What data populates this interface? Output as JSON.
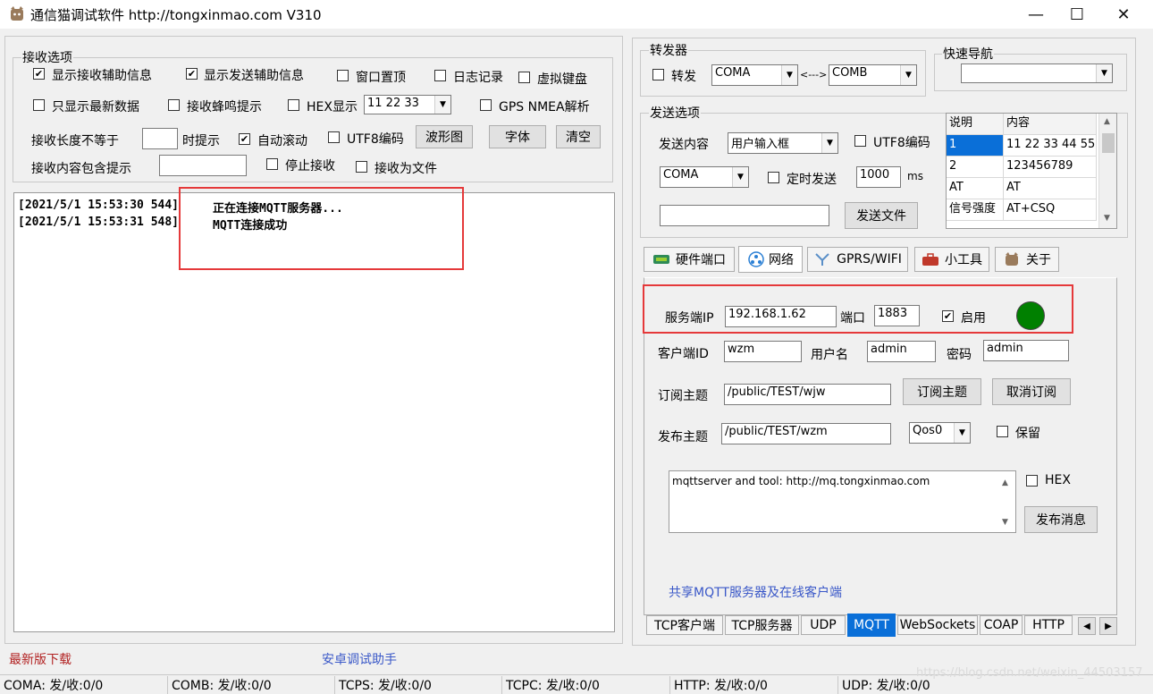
{
  "window": {
    "title": "通信猫调试软件  http://tongxinmao.com  V310",
    "minimize": "—",
    "maximize": "☐",
    "close": "✕"
  },
  "receive_options": {
    "legend": "接收选项",
    "show_recv_aux": "显示接收辅助信息",
    "show_send_aux": "显示发送辅助信息",
    "window_top": "窗口置顶",
    "log_record": "日志记录",
    "virtual_keyboard": "虚拟键盘",
    "only_latest": "只显示最新数据",
    "recv_beep": "接收蜂鸣提示",
    "hex_display": "HEX显示",
    "hex_value": "11 22 33",
    "gps_nmea": "GPS NMEA解析",
    "length_not_equal": "接收长度不等于",
    "length_value": "",
    "prompt_when": "时提示",
    "auto_scroll": "自动滚动",
    "utf8": "UTF8编码",
    "waveform_btn": "波形图",
    "font_btn": "字体",
    "clear_btn": "清空",
    "content_contains": "接收内容包含提示",
    "content_value": "",
    "stop_recv": "停止接收",
    "recv_to_file": "接收为文件"
  },
  "log": {
    "lines": [
      {
        "time": "[2021/5/1 15:53:30 544]",
        "text": "正在连接MQTT服务器..."
      },
      {
        "time": "[2021/5/1 15:53:31 548]",
        "text": "MQTT连接成功"
      }
    ]
  },
  "forwarder": {
    "legend": "转发器",
    "forward_label": "转发",
    "from_port": "COMA",
    "arrow": "<--->",
    "to_port": "COMB"
  },
  "quick_nav": {
    "legend": "快速导航",
    "value": ""
  },
  "send_options": {
    "legend": "发送选项",
    "content_label": "发送内容",
    "content_source": "用户输入框",
    "utf8": "UTF8编码",
    "port": "COMA",
    "timed_send": "定时发送",
    "interval": "1000",
    "unit": "ms",
    "file_path": "",
    "send_file_btn": "发送文件",
    "table_headers": [
      "说明",
      "内容"
    ],
    "table_rows": [
      {
        "desc": "1",
        "content": "11 22 33 44 55"
      },
      {
        "desc": "2",
        "content": "123456789"
      },
      {
        "desc": "AT",
        "content": "AT"
      },
      {
        "desc": "信号强度",
        "content": "AT+CSQ"
      }
    ]
  },
  "main_tabs": [
    "硬件端口",
    "网络",
    "GPRS/WIFI",
    "小工具",
    "关于"
  ],
  "mqtt": {
    "server_ip_label": "服务端IP",
    "server_ip": "192.168.1.62",
    "port_label": "端口",
    "port": "1883",
    "enable_label": "启用",
    "status_color": "#008000",
    "client_id_label": "客户端ID",
    "client_id": "wzm",
    "username_label": "用户名",
    "username": "admin",
    "password_label": "密码",
    "password": "admin",
    "subscribe_topic_label": "订阅主题",
    "subscribe_topic": "/public/TEST/wjw",
    "subscribe_btn": "订阅主题",
    "unsubscribe_btn": "取消订阅",
    "publish_topic_label": "发布主题",
    "publish_topic": "/public/TEST/wzm",
    "qos": "Qos0",
    "retain_label": "保留",
    "message": "mqttserver and tool: http://mq.tongxinmao.com",
    "hex_label": "HEX",
    "publish_btn": "发布消息",
    "shared_link": "共享MQTT服务器及在线客户端"
  },
  "net_tabs": [
    "TCP客户端",
    "TCP服务器",
    "UDP",
    "MQTT",
    "WebSockets",
    "COAP",
    "HTTP"
  ],
  "footer": {
    "latest_download": "最新版下载",
    "android_helper": "安卓调试助手"
  },
  "status": [
    "COMA: 发/收:0/0",
    "COMB: 发/收:0/0",
    "TCPS: 发/收:0/0",
    "TCPC: 发/收:0/0",
    "HTTP: 发/收:0/0",
    "UDP: 发/收:0/0"
  ],
  "watermark": "https://blog.csdn.net/weixin_44503157",
  "colors": {
    "accent_red": "#e5393a",
    "selected_row": "#0a6fd8",
    "link_blue": "#3a58c8"
  }
}
